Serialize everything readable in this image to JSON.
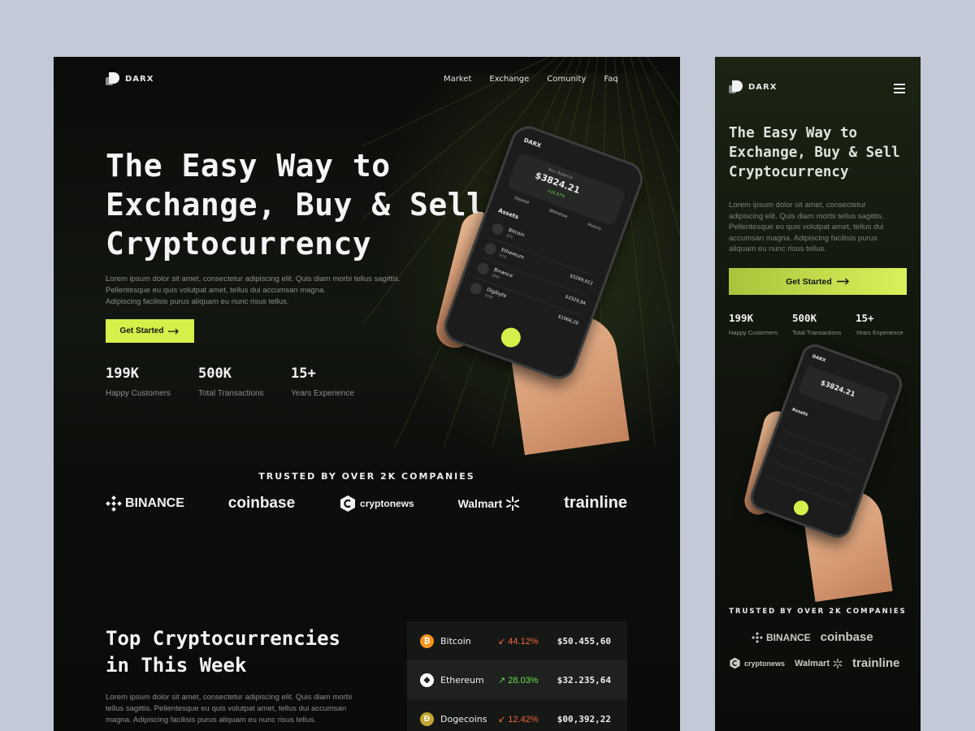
{
  "desktop": {
    "logo_text": "DARX",
    "nav": [
      "Market",
      "Exchange",
      "Comunity",
      "Faq"
    ],
    "hero": {
      "title_lines": [
        "The Easy Way to",
        "Exchange, Buy & Sell",
        "Cryptocurrency"
      ],
      "paragraph_lines": [
        "Lorem ipsum dolor sit amet, consectetur adipiscing elit. Quis diam morbi tellus sagittis.",
        "Pellentesque eu quis volutpat amet, tellus dui accumsan magna.",
        "Adipiscing facilisis purus aliquam eu nunc risus tellus."
      ],
      "cta": "Get Started"
    },
    "stats": [
      {
        "value": "199K",
        "label": "Happy Customers"
      },
      {
        "value": "500K",
        "label": "Total Transactions"
      },
      {
        "value": "15+",
        "label": "Years Experience"
      }
    ],
    "trusted_heading": "TRUSTED BY OVER 2K COMPANIES",
    "brands": [
      "BINANCE",
      "coinbase",
      "cryptonews",
      "Walmart",
      "trainline"
    ],
    "top_section": {
      "title_lines": [
        "Top Cryptocurrencies",
        "in This Week"
      ],
      "paragraph_lines": [
        "Lorem ipsum dolor sit amet, consectetur adipiscing elit. Quis diam morbi",
        "tellus sagittis. Pellentesque eu quis volutpat amet, tellus dui accumsan",
        "magna. Adipiscing facilisis purus aliquam eu nunc risus tellus."
      ]
    },
    "crypto_table": [
      {
        "name": "Bitcoin",
        "change": "44.12%",
        "direction": "down",
        "price": "$50.455,60",
        "icon": "bitcoin-icon",
        "color": "#f7931a"
      },
      {
        "name": "Ethereum",
        "change": "28.03%",
        "direction": "up",
        "price": "$32.235,64",
        "icon": "ethereum-icon",
        "color": "#ffffff"
      },
      {
        "name": "Dogecoins",
        "change": "12.42%",
        "direction": "down",
        "price": "$00,392,22",
        "icon": "dogecoin-icon",
        "color": "#c2a633"
      }
    ]
  },
  "phone_screen": {
    "brand": "DARX",
    "balance_label": "Your Balance",
    "balance": "$3824.21",
    "balance_change": "+26.67%",
    "actions": [
      "Deposit",
      "Withdraw",
      "History"
    ],
    "assets_heading": "Assets",
    "assets": [
      {
        "name": "Bitcoin",
        "sub": "BTC",
        "value": ""
      },
      {
        "name": "Ethereum",
        "sub": "ETH",
        "value": "$5269,912"
      },
      {
        "name": "Binance",
        "sub": "BNB",
        "value": "$3329,84"
      },
      {
        "name": "Digibyte",
        "sub": "DGB",
        "value": "$1068,28"
      }
    ]
  },
  "mobile": {
    "logo_text": "DARX",
    "hero": {
      "title_lines": [
        "The Easy Way to",
        "Exchange, Buy & Sell",
        "Cryptocurrency"
      ],
      "paragraph_lines": [
        "Lorem ipsum dolor sit amet, consectetur",
        "adipiscing elit. Quis diam morbi tellus sagittis.",
        "Pellentesque eu quis volutpat amet, tellus dui",
        "accumsan magna. Adipiscing facilisis purus",
        "aliquam eu nunc risus tellus."
      ],
      "cta": "Get Started"
    },
    "stats": [
      {
        "value": "199K",
        "label": "Happy Customers"
      },
      {
        "value": "500K",
        "label": "Total Transactions"
      },
      {
        "value": "15+",
        "label": "Years Experience"
      }
    ],
    "trusted_heading": "TRUSTED BY OVER 2K COMPANIES",
    "brands": [
      "BINANCE",
      "coinbase",
      "cryptonews",
      "Walmart",
      "trainline"
    ]
  },
  "colors": {
    "accent": "#d6ef4a",
    "background": "#0b0c0a",
    "page_background": "#c3c9d6",
    "down": "#f0663a",
    "up": "#6ddc57"
  }
}
